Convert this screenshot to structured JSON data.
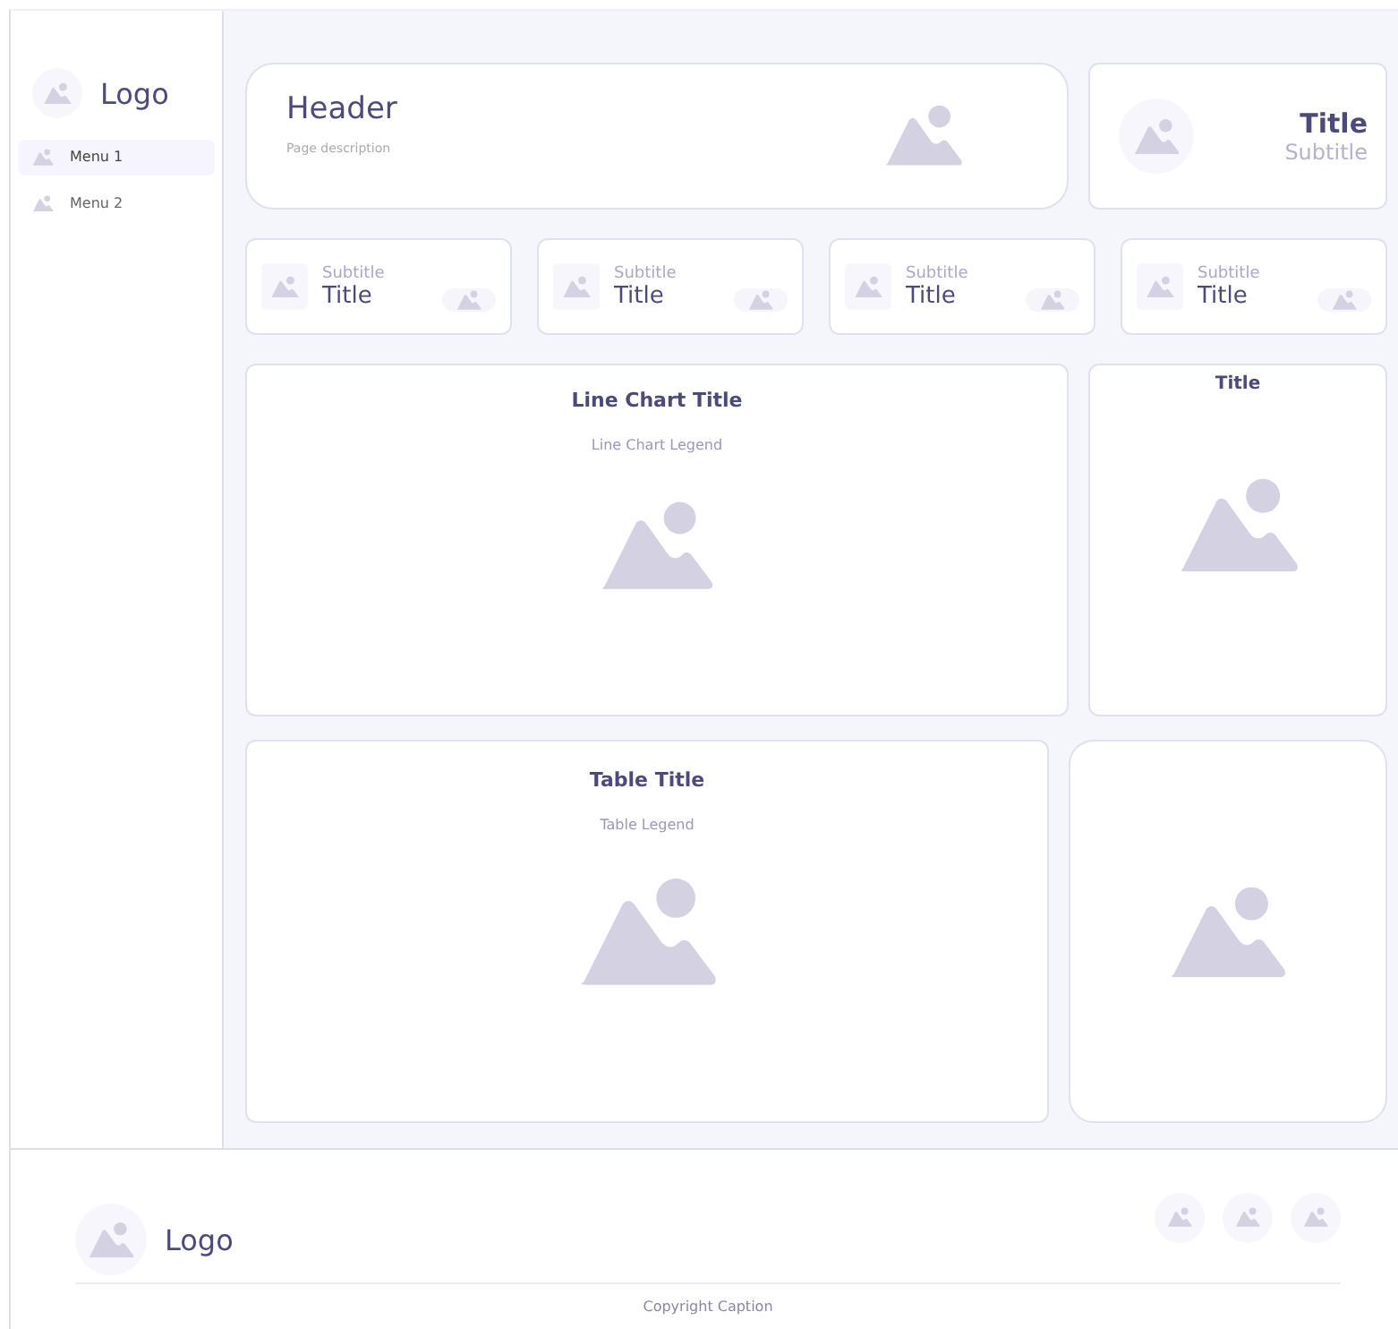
{
  "sidebar": {
    "logo": "Logo",
    "items": [
      {
        "label": "Menu 1",
        "selected": true
      },
      {
        "label": "Menu 2",
        "selected": false
      }
    ]
  },
  "header": {
    "title": "Header",
    "description": "Page description"
  },
  "title_card": {
    "title": "Title",
    "subtitle": "Subtitle"
  },
  "stat_cards": [
    {
      "subtitle": "Subtitle",
      "title": "Title"
    },
    {
      "subtitle": "Subtitle",
      "title": "Title"
    },
    {
      "subtitle": "Subtitle",
      "title": "Title"
    },
    {
      "subtitle": "Subtitle",
      "title": "Title"
    }
  ],
  "line_chart_card": {
    "title": "Line Chart Title",
    "legend": "Line Chart Legend"
  },
  "side_card": {
    "title": "Title"
  },
  "table_card": {
    "title": "Table Title",
    "legend": "Table Legend"
  },
  "footer": {
    "logo": "Logo",
    "copyright": "Copyright Caption"
  }
}
